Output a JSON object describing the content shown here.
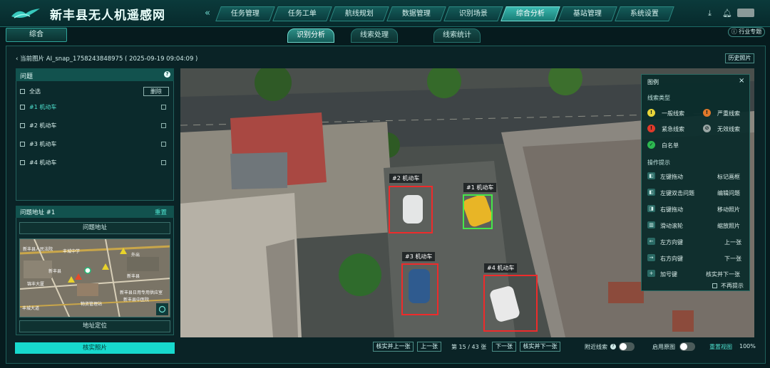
{
  "header": {
    "title": "新丰县无人机遥感网",
    "nav": [
      "任务管理",
      "任务工单",
      "航线规划",
      "数据管理",
      "识别场景",
      "综合分析",
      "基站管理",
      "系统设置"
    ],
    "active_nav": "综合分析"
  },
  "subnav": {
    "left_tab": "综合",
    "tabs": [
      "识别分析",
      "线索处理",
      "线索统计"
    ],
    "active_tab": "识别分析",
    "industry_button": "行业专题"
  },
  "breadcrumb": {
    "back": "‹",
    "text": "当前图片 AI_snap_1758243848975 ( 2025-09-19 09:04:09 )"
  },
  "history_button": "历史照片",
  "problems": {
    "title": "问题",
    "select_all": "全选",
    "delete": "删除",
    "items": [
      {
        "label": "#1  机动车"
      },
      {
        "label": "#2  机动车"
      },
      {
        "label": "#3  机动车"
      },
      {
        "label": "#4  机动车"
      }
    ]
  },
  "address": {
    "title": "问题地址 #1",
    "reset": "重置",
    "problem_address": "问题地址",
    "locate": "地址定位",
    "map_labels": [
      "新丰县人民法院",
      "新丰县",
      "外出",
      "丰城中学",
      "新丰县",
      "锦丰大厦",
      "新丰县日用专用供应室",
      "新丰县中医院",
      "物资管理站",
      "丰城大道"
    ]
  },
  "verify_button": "核实照片",
  "detections": [
    {
      "label": "#1 机动车",
      "color": "green"
    },
    {
      "label": "#2 机动车",
      "color": "red"
    },
    {
      "label": "#3 机动车",
      "color": "red"
    },
    {
      "label": "#4 机动车",
      "color": "red"
    }
  ],
  "legend": {
    "title": "图例",
    "close": "×",
    "clue_type_title": "线索类型",
    "clue_types": [
      "一般线索",
      "严重线索",
      "紧急线索",
      "无效线索",
      "白名单"
    ],
    "ops_title": "操作提示",
    "ops": [
      {
        "key": "左键拖动",
        "action": "标记画框"
      },
      {
        "key": "左键双击问题",
        "action": "编辑问题"
      },
      {
        "key": "右键拖动",
        "action": "移动照片"
      },
      {
        "key": "滑动滚轮",
        "action": "缩放照片"
      },
      {
        "key": "左方向键",
        "action": "上一张"
      },
      {
        "key": "右方向键",
        "action": "下一张"
      },
      {
        "key": "加号键",
        "action": "核实并下一张"
      }
    ],
    "no_more": "不再提示"
  },
  "bottom": {
    "verify_prev": "核实并上一张",
    "prev": "上一张",
    "page": "第 15 / 43 张",
    "next": "下一张",
    "verify_next": "核实并下一张",
    "nearby": "附近线索",
    "original": "启用原图",
    "reset_view": "重置视图",
    "zoom": "100%"
  },
  "colors": {
    "accent": "#17d9cd",
    "detect_red": "#ee2b2b",
    "detect_green": "#46e64a"
  }
}
